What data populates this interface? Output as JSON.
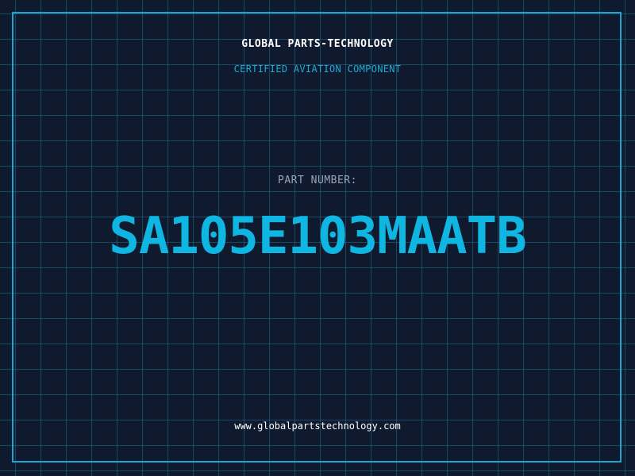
{
  "header": {
    "brand": "GLOBAL PARTS-TECHNOLOGY",
    "subtitle": "CERTIFIED AVIATION COMPONENT"
  },
  "main": {
    "label": "PART NUMBER:",
    "part_number": "SA105E103MAATB"
  },
  "footer": {
    "url": "www.globalpartstechnology.com"
  },
  "colors": {
    "background": "#0f1a2e",
    "grid": "#2896af",
    "accent": "#10b6e2",
    "text": "#ffffff",
    "muted": "#9aa6b8"
  }
}
